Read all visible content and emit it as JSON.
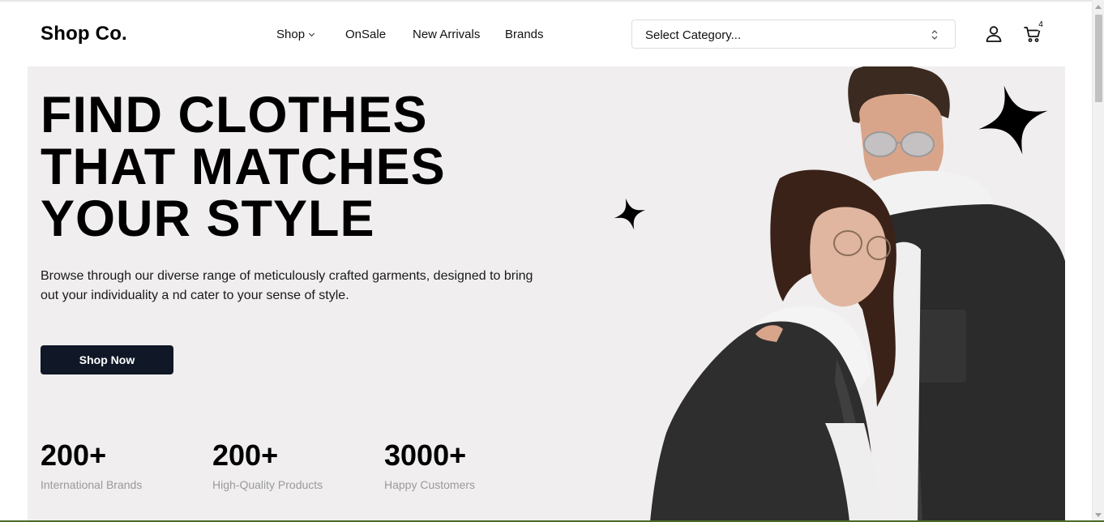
{
  "header": {
    "logo": "Shop Co.",
    "nav": [
      {
        "label": "Shop",
        "has_dropdown": true
      },
      {
        "label": "OnSale"
      },
      {
        "label": "New Arrivals"
      },
      {
        "label": "Brands"
      }
    ],
    "category_select": {
      "value": "Select Category..."
    },
    "cart_count": "4",
    "icons": {
      "user": "user-icon",
      "cart": "cart-icon"
    }
  },
  "hero": {
    "headline": [
      "FIND CLOTHES",
      "THAT MATCHES",
      "YOUR STYLE"
    ],
    "description_line1": "Browse through our diverse range of meticulously crafted garments, designed to bring",
    "description_line2": "out your individuality a nd cater to your sense of style.",
    "cta_label": "Shop Now",
    "stats": [
      {
        "value": "200+",
        "label": "International Brands"
      },
      {
        "value": "200+",
        "label": "High-Quality Products"
      },
      {
        "value": "3000+",
        "label": "Happy Customers"
      }
    ],
    "image": "couple-fashion-photo"
  },
  "colors": {
    "hero_bg": "#f0eeef",
    "button_bg": "#101827",
    "stat_label": "#9a9a9a"
  }
}
